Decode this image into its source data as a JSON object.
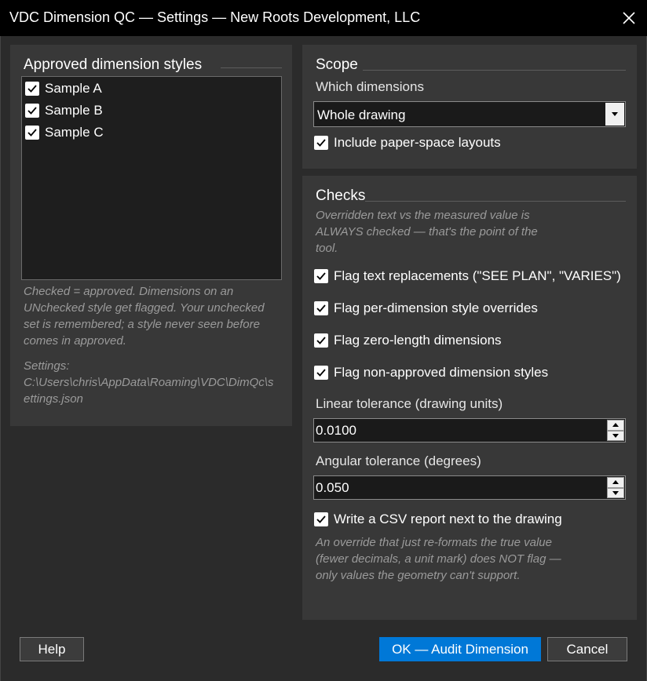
{
  "window": {
    "title": "VDC Dimension QC — Settings — New Roots Development, LLC"
  },
  "styles_panel": {
    "title": "Approved dimension styles",
    "items": [
      {
        "label": "Sample A",
        "checked": true
      },
      {
        "label": "Sample B",
        "checked": true
      },
      {
        "label": "Sample C",
        "checked": true
      }
    ],
    "note": "Checked = approved. Dimensions on an UNchecked style get flagged. Your unchecked set is remembered; a style never seen before comes in approved.",
    "settings_label": "Settings:",
    "settings_path": "C:\\Users\\chris\\AppData\\Roaming\\VDC\\DimQc\\settings.json"
  },
  "scope": {
    "title": "Scope",
    "which_label": "Which dimensions",
    "which_value": "Whole drawing",
    "include_paper_label": "Include paper-space layouts",
    "include_paper_checked": true
  },
  "checks": {
    "title": "Checks",
    "note_line1": "Overridden text vs the measured value is",
    "note_line2_em": "ALWAYS",
    "note_line2_rest": " checked — that's the point of the",
    "note_line3": "tool.",
    "flag_text_replacements": "Flag text replacements (\"SEE PLAN\", \"VARIES\")",
    "flag_style_overrides": "Flag per-dimension style overrides",
    "flag_zero_length": "Flag zero-length dimensions",
    "flag_non_approved": "Flag non-approved dimension styles",
    "linear_label": "Linear tolerance (drawing units)",
    "linear_value": "0.0100",
    "angular_label": "Angular tolerance (degrees)",
    "angular_value": "0.050",
    "csv_label": "Write a CSV report next to the drawing",
    "footer_note": "An override that just re-formats the true value (fewer decimals, a unit mark) does NOT flag — only values the geometry can't support."
  },
  "buttons": {
    "help": "Help",
    "ok": "OK — Audit Dimension",
    "cancel": "Cancel"
  },
  "colors": {
    "primary": "#0078d7",
    "panel": "#383838",
    "background": "#2b2b2b"
  }
}
